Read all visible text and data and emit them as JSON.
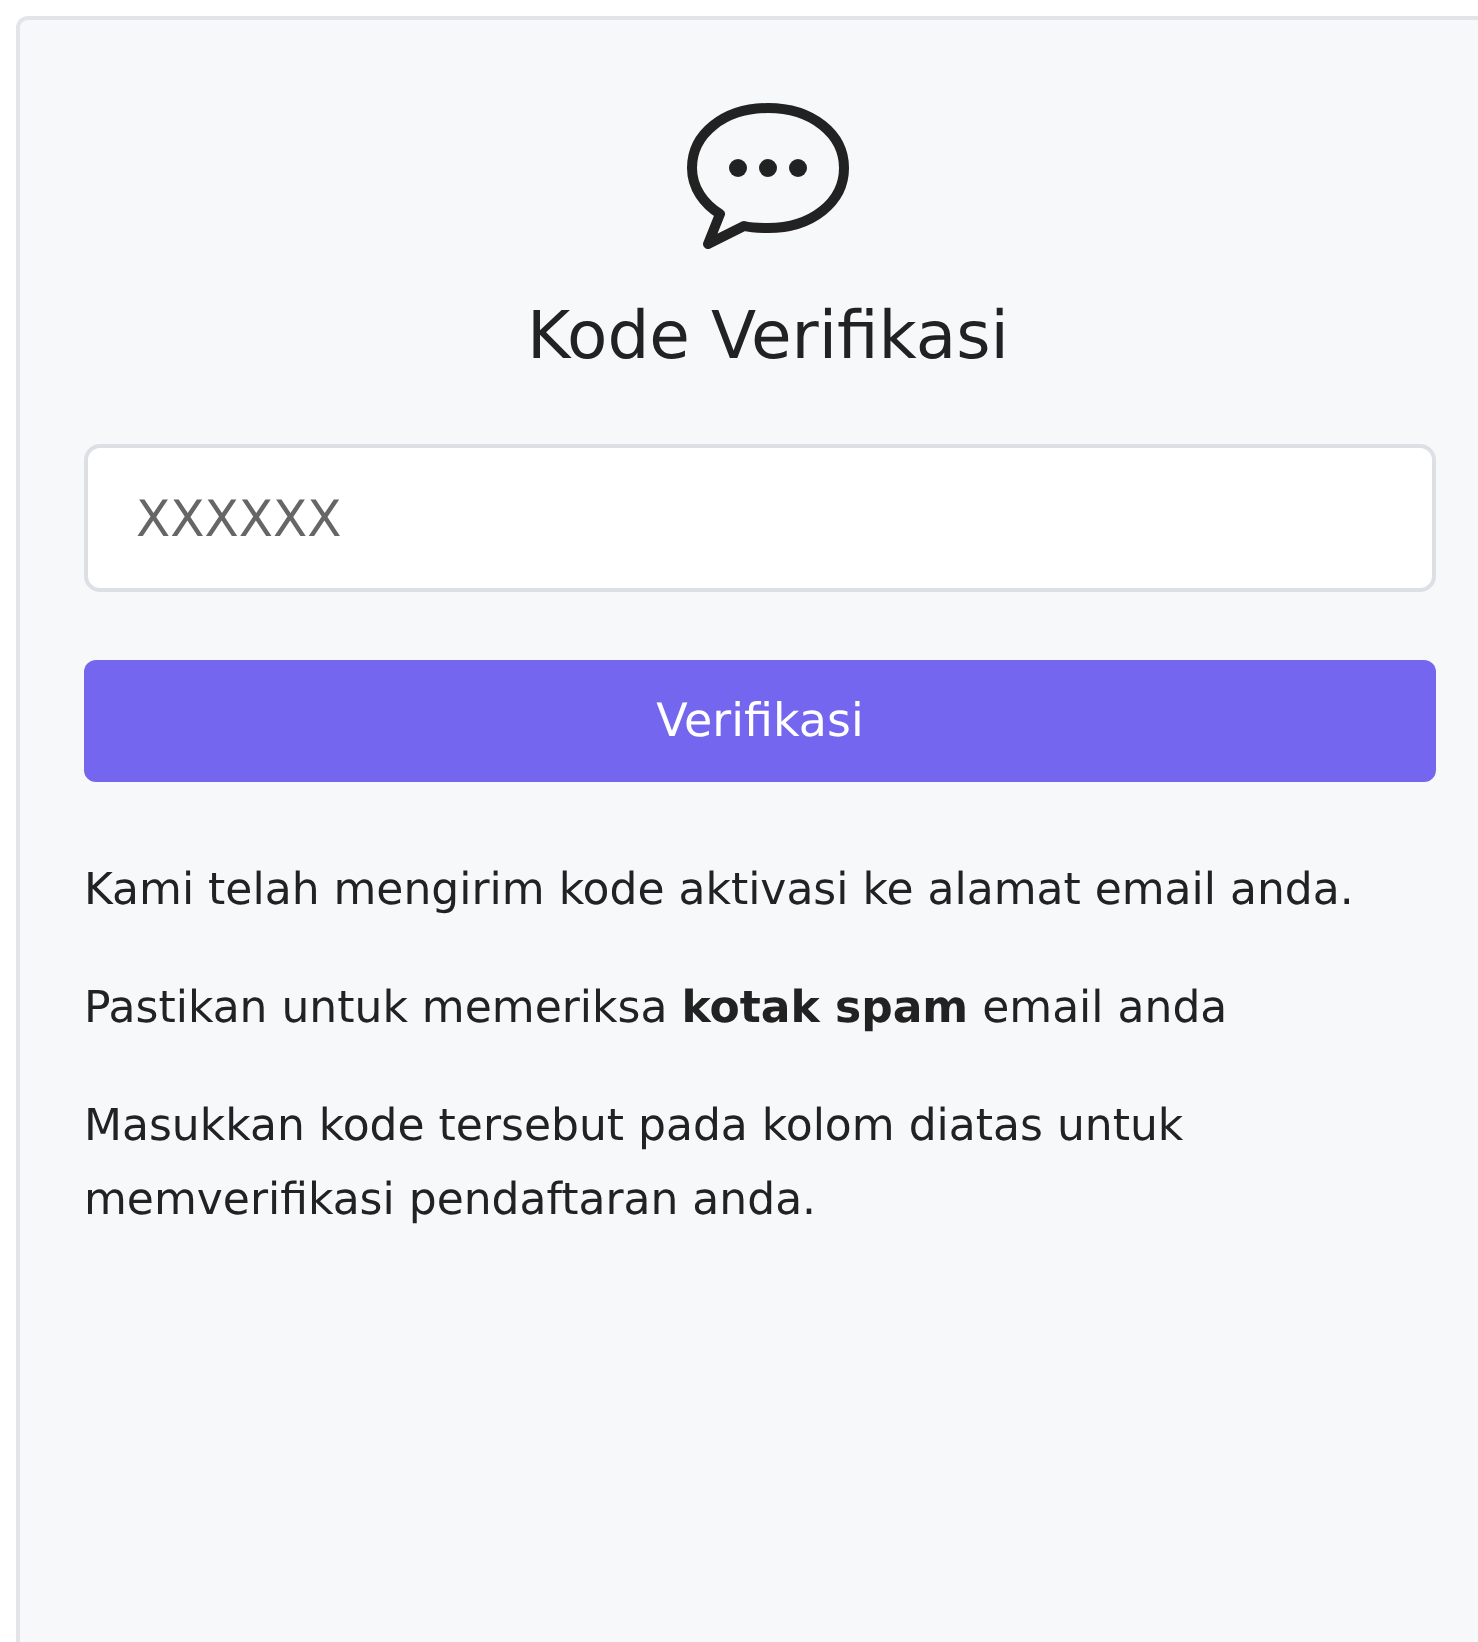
{
  "title": "Kode Verifikasi",
  "code_field": {
    "placeholder": "XXXXXX"
  },
  "submit_button": {
    "label": "Verifikasi"
  },
  "paragraphs": [
    "Kami telah mengirim kode aktivasi ke alamat email anda.",
    "Pastikan untuk memeriksa **kotak spam** email anda",
    "Masukkan kode tersebut pada kolom diatas untuk memverifikasi pendaftaran anda."
  ]
}
